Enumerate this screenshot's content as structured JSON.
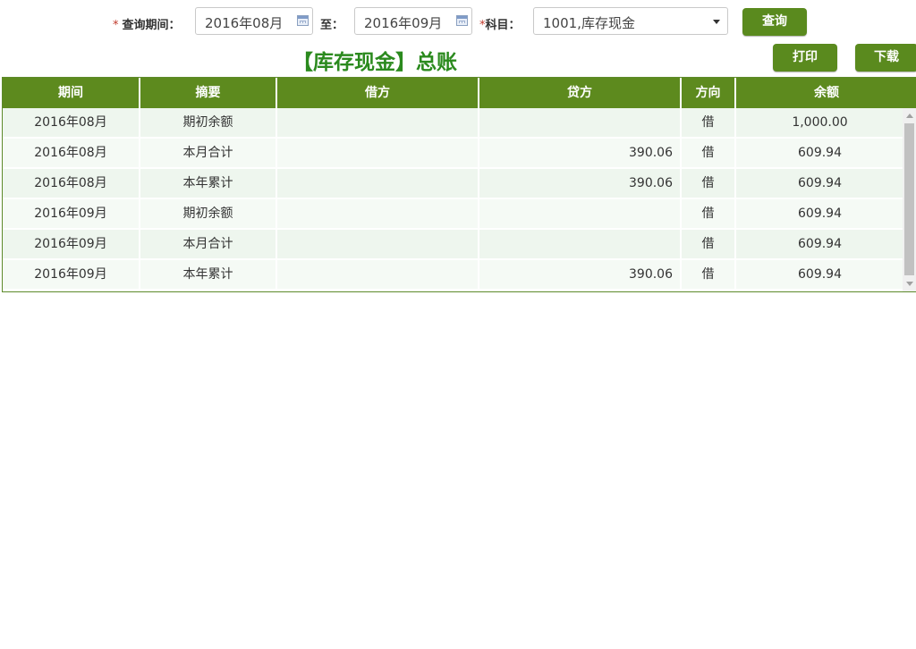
{
  "filters": {
    "required_mark": "*",
    "period_label": "查询期间：",
    "period_from": "2016年08月",
    "to_label": "至：",
    "period_to": "2016年09月",
    "subject_label": "科目：",
    "subject_value": "1001,库存现金",
    "query_button": "查询"
  },
  "report": {
    "title": "【库存现金】总账",
    "print_button": "打印",
    "download_button": "下载"
  },
  "table": {
    "headers": {
      "period": "期间",
      "summary": "摘要",
      "debit": "借方",
      "credit": "贷方",
      "direction": "方向",
      "balance": "余额"
    },
    "rows": [
      {
        "period": "2016年08月",
        "summary": "期初余额",
        "debit": "",
        "credit": "",
        "direction": "借",
        "balance": "1,000.00"
      },
      {
        "period": "2016年08月",
        "summary": "本月合计",
        "debit": "",
        "credit": "390.06",
        "direction": "借",
        "balance": "609.94"
      },
      {
        "period": "2016年08月",
        "summary": "本年累计",
        "debit": "",
        "credit": "390.06",
        "direction": "借",
        "balance": "609.94"
      },
      {
        "period": "2016年09月",
        "summary": "期初余额",
        "debit": "",
        "credit": "",
        "direction": "借",
        "balance": "609.94"
      },
      {
        "period": "2016年09月",
        "summary": "本月合计",
        "debit": "",
        "credit": "",
        "direction": "借",
        "balance": "609.94"
      },
      {
        "period": "2016年09月",
        "summary": "本年累计",
        "debit": "",
        "credit": "390.06",
        "direction": "借",
        "balance": "609.94"
      }
    ]
  },
  "icons": {
    "calendar": "calendar-icon",
    "dropdown": "chevron-down-icon"
  },
  "colors": {
    "accent": "#5d8a1e",
    "title": "#2b8a1e",
    "row_odd": "#eef6ee",
    "row_even": "#f5faf5"
  }
}
